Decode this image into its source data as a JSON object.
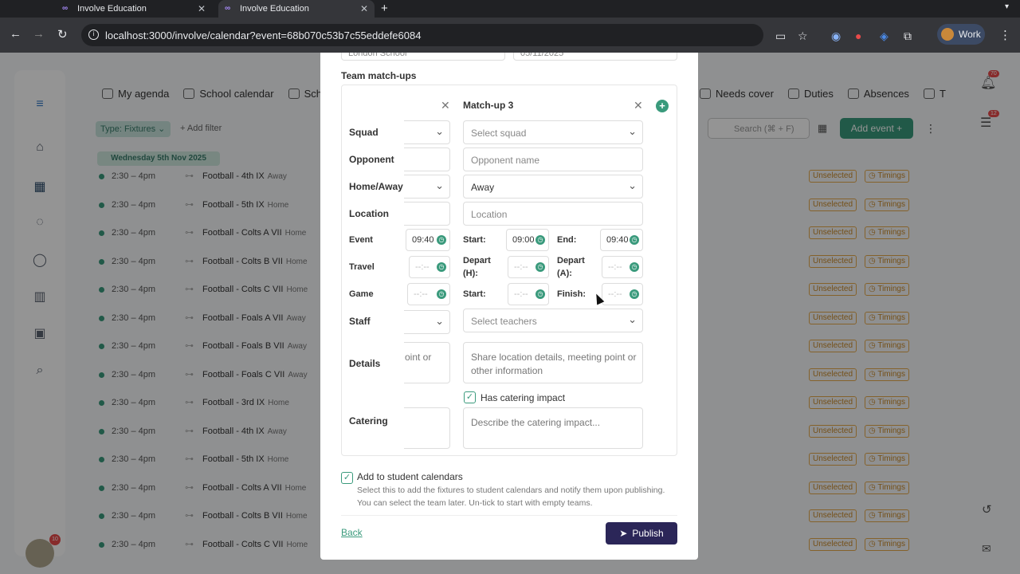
{
  "browser": {
    "tabs": [
      {
        "title": "Involve Education"
      },
      {
        "title": "Involve Education"
      }
    ],
    "url": "localhost:3000/involve/calendar?event=68b070c53b7c55eddefe6084",
    "profile_label": "Work"
  },
  "app": {
    "nav_left": [
      "My agenda",
      "School calendar",
      "Sche"
    ],
    "nav_right": [
      "Needs cover",
      "Duties",
      "Absences",
      "T"
    ],
    "filter_chip": "Type: Fixtures",
    "add_filter": "+ Add filter",
    "search_placeholder": "Search (⌘ + F)",
    "add_event": "Add event",
    "notif_count": "70",
    "tasks_count": "12",
    "avatar_badge": "10",
    "date_band": "Wednesday 5th Nov 2025",
    "unselected_label": "Unselected",
    "timings_label": "Timings",
    "events": [
      {
        "time": "2:30 – 4pm",
        "title": "Football - 4th IX",
        "ha": "Away"
      },
      {
        "time": "2:30 – 4pm",
        "title": "Football - 5th IX",
        "ha": "Home"
      },
      {
        "time": "2:30 – 4pm",
        "title": "Football - Colts A VII",
        "ha": "Home"
      },
      {
        "time": "2:30 – 4pm",
        "title": "Football - Colts B VII",
        "ha": "Home"
      },
      {
        "time": "2:30 – 4pm",
        "title": "Football - Colts C VII",
        "ha": "Home"
      },
      {
        "time": "2:30 – 4pm",
        "title": "Football - Foals A VII",
        "ha": "Away"
      },
      {
        "time": "2:30 – 4pm",
        "title": "Football - Foals B VII",
        "ha": "Away"
      },
      {
        "time": "2:30 – 4pm",
        "title": "Football - Foals C VII",
        "ha": "Away"
      },
      {
        "time": "2:30 – 4pm",
        "title": "Football - 3rd IX",
        "ha": "Home"
      },
      {
        "time": "2:30 – 4pm",
        "title": "Football - 4th IX",
        "ha": "Away"
      },
      {
        "time": "2:30 – 4pm",
        "title": "Football - 5th IX",
        "ha": "Home"
      },
      {
        "time": "2:30 – 4pm",
        "title": "Football - Colts A VII",
        "ha": "Home"
      },
      {
        "time": "2:30 – 4pm",
        "title": "Football - Colts B VII",
        "ha": "Home"
      },
      {
        "time": "2:30 – 4pm",
        "title": "Football - Colts C VII",
        "ha": "Home"
      }
    ]
  },
  "modal": {
    "prev_field_1": "London School",
    "prev_field_2": "05/11/2025",
    "section_title": "Team match-ups",
    "labels": {
      "squad": "Squad",
      "opponent": "Opponent",
      "home_away": "Home/Away",
      "location": "Location",
      "event": "Event",
      "travel": "Travel",
      "game": "Game",
      "staff": "Staff",
      "details": "Details",
      "catering": "Catering"
    },
    "col1": {
      "event_time": "09:40",
      "empty_time": "--:--",
      "details_partial": "oint or"
    },
    "matchup": {
      "title": "Match-up 3",
      "squad_placeholder": "Select squad",
      "opponent_placeholder": "Opponent name",
      "home_away_value": "Away",
      "location_placeholder": "Location",
      "start_label": "Start:",
      "end_label": "End:",
      "start_time": "09:00",
      "end_time": "09:40",
      "depart_h_label": "Depart (H):",
      "depart_a_label": "Depart (A):",
      "game_start_label": "Start:",
      "finish_label": "Finish:",
      "empty_time": "--:--",
      "staff_placeholder": "Select teachers",
      "details_placeholder": "Share location details, meeting point or other information",
      "catering_checkbox_label": "Has catering impact",
      "catering_placeholder": "Describe the catering impact..."
    },
    "student_calendars_label": "Add to student calendars",
    "student_calendars_desc": "Select this to add the fixtures to student calendars and notify them upon publishing. You can select the team later. Un-tick to start with empty teams.",
    "back_label": "Back",
    "publish_label": "Publish"
  },
  "colors": {
    "accent": "#3a9a7c",
    "publish": "#2b2658",
    "warning": "#e6a94a"
  }
}
